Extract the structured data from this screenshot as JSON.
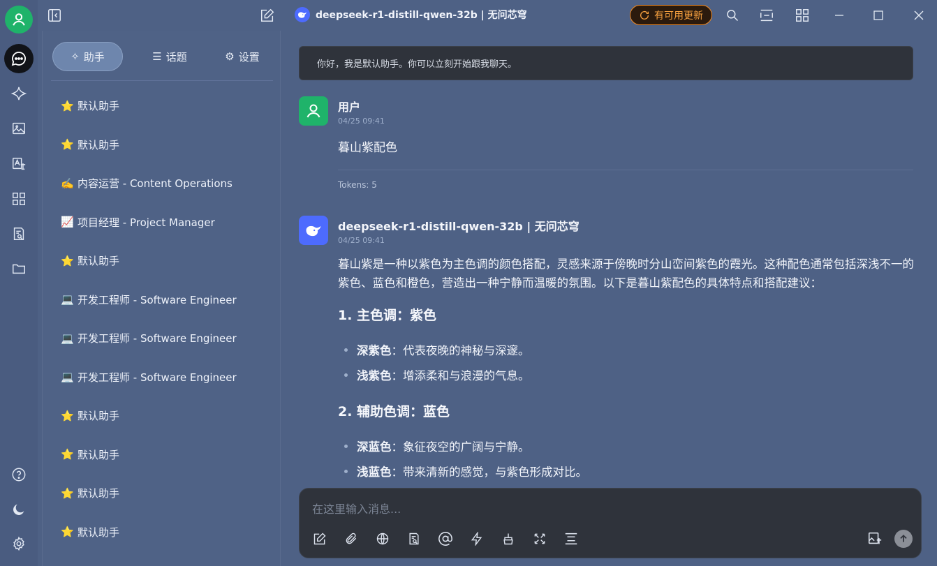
{
  "app": {
    "title": "deepseek-r1-distill-qwen-32b | 无问芯穹",
    "update_label": "有可用更新"
  },
  "sidebar": {
    "tabs": [
      {
        "label": "助手",
        "icon": "sparkle-icon"
      },
      {
        "label": "话题",
        "icon": "list-icon"
      },
      {
        "label": "设置",
        "icon": "gear-icon"
      }
    ],
    "assistants": [
      {
        "emoji": "⭐",
        "label": "默认助手"
      },
      {
        "emoji": "⭐",
        "label": "默认助手"
      },
      {
        "emoji": "✍️",
        "label": "内容运营 - Content Operations"
      },
      {
        "emoji": "📈",
        "label": "项目经理 - Project Manager"
      },
      {
        "emoji": "⭐",
        "label": "默认助手"
      },
      {
        "emoji": "💻",
        "label": "开发工程师 - Software Engineer"
      },
      {
        "emoji": "💻",
        "label": "开发工程师 - Software Engineer"
      },
      {
        "emoji": "💻",
        "label": "开发工程师 - Software Engineer"
      },
      {
        "emoji": "⭐",
        "label": "默认助手"
      },
      {
        "emoji": "⭐",
        "label": "默认助手"
      },
      {
        "emoji": "⭐",
        "label": "默认助手"
      },
      {
        "emoji": "⭐",
        "label": "默认助手"
      }
    ]
  },
  "chat": {
    "welcome": "你好，我是默认助手。你可以立刻开始跟我聊天。",
    "user_message": {
      "name": "用户",
      "time": "04/25 09:41",
      "text": "暮山紫配色",
      "tokens": "Tokens: 5"
    },
    "assistant_message": {
      "name": "deepseek-r1-distill-qwen-32b | 无问芯穹",
      "time": "04/25 09:41",
      "intro": "暮山紫是一种以紫色为主色调的颜色搭配，灵感来源于傍晚时分山峦间紫色的霞光。这种配色通常包括深浅不一的紫色、蓝色和橙色，营造出一种宁静而温暖的氛围。以下是暮山紫配色的具体特点和搭配建议：",
      "sections": [
        {
          "heading": "1. 主色调：紫色",
          "items": [
            {
              "term": "深紫色",
              "desc": "：代表夜晚的神秘与深邃。"
            },
            {
              "term": "浅紫色",
              "desc": "：增添柔和与浪漫的气息。"
            }
          ]
        },
        {
          "heading": "2. 辅助色调：蓝色",
          "items": [
            {
              "term": "深蓝色",
              "desc": "：象征夜空的广阔与宁静。"
            },
            {
              "term": "浅蓝色",
              "desc": "：带来清新的感觉，与紫色形成对比。"
            }
          ]
        }
      ]
    }
  },
  "input": {
    "placeholder": "在这里输入消息..."
  },
  "colors": {
    "accent_green": "#1fb36a",
    "update_orange": "#f08a24",
    "deepseek_blue": "#4d6bfe"
  }
}
